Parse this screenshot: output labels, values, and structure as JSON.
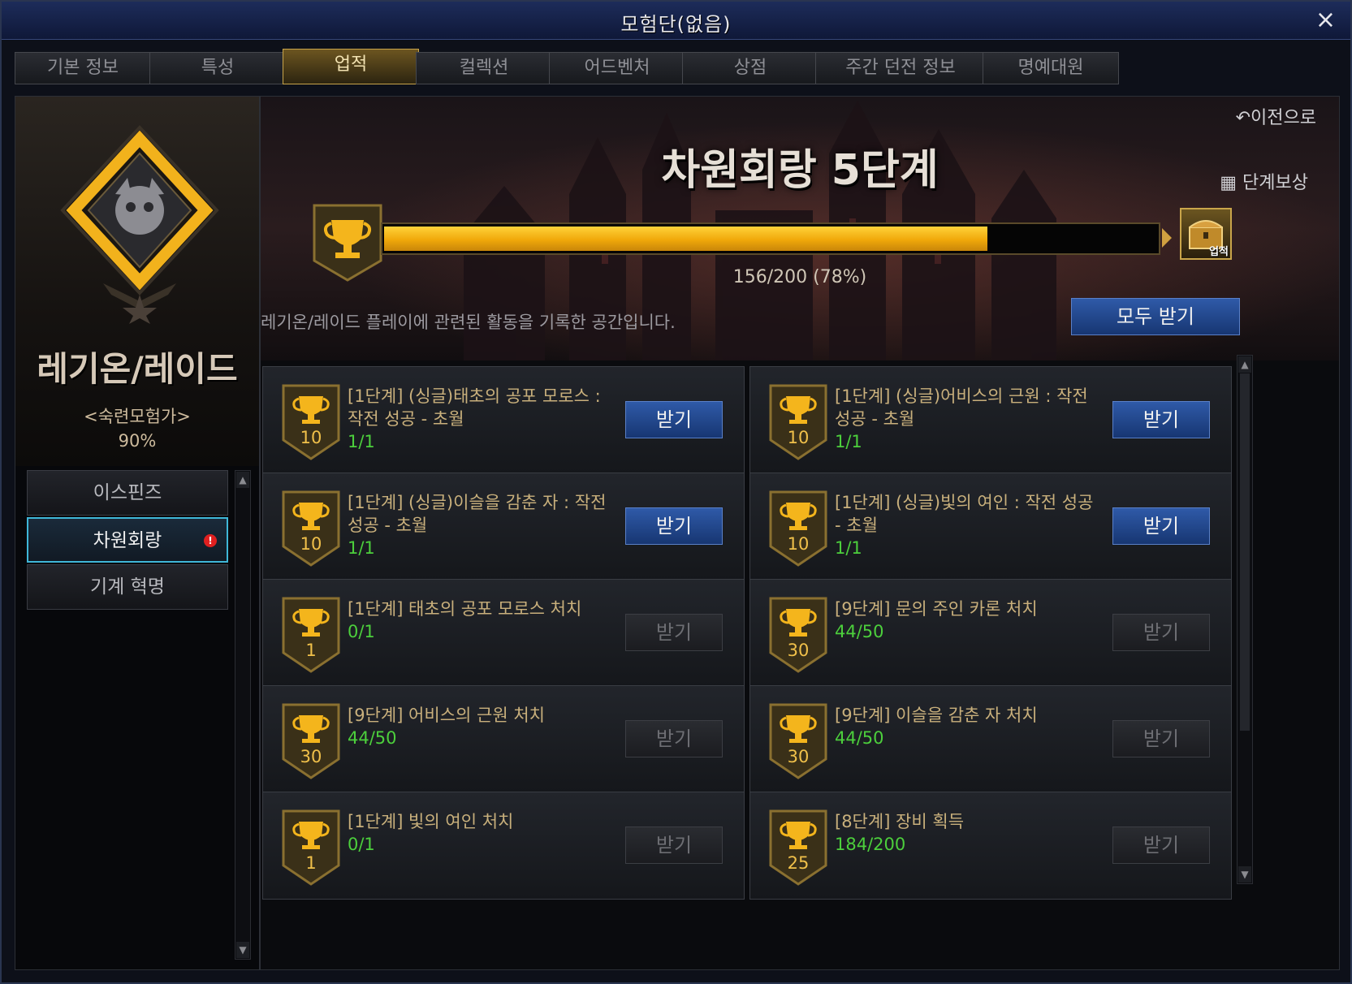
{
  "window": {
    "title": "모험단(없음)",
    "close_label": "×"
  },
  "tabs": [
    {
      "label": "기본 정보"
    },
    {
      "label": "특성"
    },
    {
      "label": "업적"
    },
    {
      "label": "컬렉션"
    },
    {
      "label": "어드벤처"
    },
    {
      "label": "상점"
    },
    {
      "label": "주간 던전 정보"
    },
    {
      "label": "명예대원"
    }
  ],
  "active_tab": "업적",
  "category": {
    "title": "레기온/레이드",
    "rank": "<숙련모험가>",
    "percent": "90%"
  },
  "nav": [
    {
      "label": "이스핀즈",
      "alert": false
    },
    {
      "label": "차원회랑",
      "alert": true,
      "alert_glyph": "!"
    },
    {
      "label": "기계 혁명",
      "alert": false
    }
  ],
  "header": {
    "back_label": "이전으로",
    "stage_title": "차원회랑 5단계",
    "progress_text": "156/200 (78%)",
    "progress_fraction": 0.78,
    "reward_label": "단계보상",
    "reward_tag": "업적",
    "description": "레기온/레이드 플레이에 관련된 활동을 기록한 공간입니다.",
    "receive_all_label": "모두 받기"
  },
  "achievements": [
    {
      "title": "[1단계] (싱글)태초의 공포 모로스 : 작전 성공 - 초월",
      "progress": "1/1",
      "points": "10",
      "button": "받기",
      "claimable": true
    },
    {
      "title": "[1단계] (싱글)어비스의 근원 : 작전 성공 - 초월",
      "progress": "1/1",
      "points": "10",
      "button": "받기",
      "claimable": true
    },
    {
      "title": "[1단계] (싱글)이슬을 감춘 자 : 작전 성공 - 초월",
      "progress": "1/1",
      "points": "10",
      "button": "받기",
      "claimable": true
    },
    {
      "title": "[1단계] (싱글)빛의 여인 : 작전 성공 - 초월",
      "progress": "1/1",
      "points": "10",
      "button": "받기",
      "claimable": true
    },
    {
      "title": "[1단계] 태초의 공포 모로스 처치",
      "progress": "0/1",
      "points": "1",
      "button": "받기",
      "claimable": false
    },
    {
      "title": "[9단계] 문의 주인 카론 처치",
      "progress": "44/50",
      "points": "30",
      "button": "받기",
      "claimable": false
    },
    {
      "title": "[9단계] 어비스의 근원 처치",
      "progress": "44/50",
      "points": "30",
      "button": "받기",
      "claimable": false
    },
    {
      "title": "[9단계] 이슬을 감춘 자 처치",
      "progress": "44/50",
      "points": "30",
      "button": "받기",
      "claimable": false
    },
    {
      "title": "[1단계] 빛의 여인 처치",
      "progress": "0/1",
      "points": "1",
      "button": "받기",
      "claimable": false
    },
    {
      "title": "[8단계] 장비 획득",
      "progress": "184/200",
      "points": "25",
      "button": "받기",
      "claimable": false
    }
  ],
  "colors": {
    "gold": "#f0b020",
    "progress_green": "#4ccf3c",
    "button_blue": "#2f5aa8",
    "active_nav_border": "#3fb7d8"
  }
}
